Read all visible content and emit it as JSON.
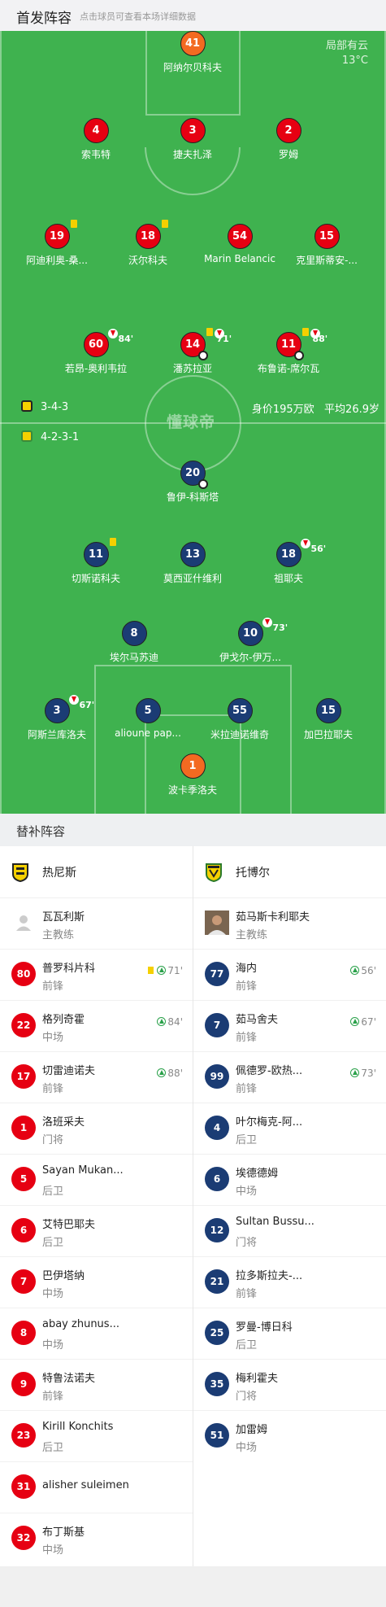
{
  "header": {
    "title": "首发阵容",
    "subtitle": "点击球员可查看本场详细数据"
  },
  "weather": {
    "line1": "局部有云",
    "line2": "13°C"
  },
  "pitch_logo": "懂球帝",
  "home": {
    "formation": "3-4-3",
    "players": [
      {
        "num": "41",
        "name": "阿纳尔贝科夫",
        "color": "orange"
      },
      {
        "num": "4",
        "name": "索韦特",
        "color": "red"
      },
      {
        "num": "3",
        "name": "捷夫扎泽",
        "color": "red"
      },
      {
        "num": "2",
        "name": "罗姆",
        "color": "red"
      },
      {
        "num": "19",
        "name": "阿迪利奥-桑...",
        "color": "red"
      },
      {
        "num": "18",
        "name": "沃尔科夫",
        "color": "red"
      },
      {
        "num": "54",
        "name": "Marin Belancic",
        "color": "red"
      },
      {
        "num": "15",
        "name": "克里斯蒂安-...",
        "color": "red"
      },
      {
        "num": "60",
        "name": "若昂-奥利韦拉",
        "color": "red",
        "sub_time": "84'"
      },
      {
        "num": "14",
        "name": "潘苏拉亚",
        "color": "red",
        "sub_time": "71'"
      },
      {
        "num": "11",
        "name": "布鲁诺-席尔瓦",
        "color": "red",
        "sub_time": "88'"
      }
    ]
  },
  "value_info": {
    "value": "身价195万欧",
    "age": "平均26.9岁"
  },
  "away": {
    "formation": "4-2-3-1",
    "players": [
      {
        "num": "20",
        "name": "鲁伊-科斯塔",
        "color": "blue"
      },
      {
        "num": "11",
        "name": "切斯诺科夫",
        "color": "blue"
      },
      {
        "num": "13",
        "name": "莫西亚什维利",
        "color": "blue"
      },
      {
        "num": "18",
        "name": "祖耶夫",
        "color": "blue",
        "sub_time": "56'"
      },
      {
        "num": "8",
        "name": "埃尔马苏迪",
        "color": "blue"
      },
      {
        "num": "10",
        "name": "伊戈尔-伊万...",
        "color": "blue",
        "sub_time": "73'"
      },
      {
        "num": "3",
        "name": "阿斯兰库洛夫",
        "color": "blue",
        "sub_time": "67'"
      },
      {
        "num": "5",
        "name": "alioune pap...",
        "color": "blue"
      },
      {
        "num": "55",
        "name": "米拉迪诺维奇",
        "color": "blue"
      },
      {
        "num": "15",
        "name": "加巴拉耶夫",
        "color": "blue"
      },
      {
        "num": "1",
        "name": "波卡季洛夫",
        "color": "orange"
      }
    ]
  },
  "subs": {
    "title": "替补阵容",
    "home_team": "热尼斯",
    "away_team": "托博尔",
    "home_coach": {
      "name": "瓦瓦利斯",
      "role": "主教练"
    },
    "away_coach": {
      "name": "茹马斯卡利耶夫",
      "role": "主教练"
    },
    "home": [
      {
        "num": "80",
        "name": "普罗科片科",
        "pos": "前锋",
        "time": "71'"
      },
      {
        "num": "22",
        "name": "格列奇霍",
        "pos": "中场",
        "time": "84'"
      },
      {
        "num": "17",
        "name": "切雷迪诺夫",
        "pos": "前锋",
        "time": "88'"
      },
      {
        "num": "1",
        "name": "洛班采夫",
        "pos": "门将",
        "time": ""
      },
      {
        "num": "5",
        "name": "Sayan Mukan...",
        "pos": "后卫",
        "time": ""
      },
      {
        "num": "6",
        "name": "艾特巴耶夫",
        "pos": "后卫",
        "time": ""
      },
      {
        "num": "7",
        "name": "巴伊塔纳",
        "pos": "中场",
        "time": ""
      },
      {
        "num": "8",
        "name": "abay zhunus...",
        "pos": "中场",
        "time": ""
      },
      {
        "num": "9",
        "name": "特鲁法诺夫",
        "pos": "前锋",
        "time": ""
      },
      {
        "num": "23",
        "name": "Kirill Konchits",
        "pos": "后卫",
        "time": ""
      },
      {
        "num": "31",
        "name": "alisher suleimen",
        "pos": "",
        "time": ""
      },
      {
        "num": "32",
        "name": "布丁斯基",
        "pos": "中场",
        "time": ""
      }
    ],
    "away": [
      {
        "num": "77",
        "name": "海内",
        "pos": "前锋",
        "time": "56'"
      },
      {
        "num": "7",
        "name": "茹马舍夫",
        "pos": "前锋",
        "time": "67'"
      },
      {
        "num": "99",
        "name": "佩德罗-欧热...",
        "pos": "前锋",
        "time": "73'"
      },
      {
        "num": "4",
        "name": "叶尔梅克-阿...",
        "pos": "后卫",
        "time": ""
      },
      {
        "num": "6",
        "name": "埃德德姆",
        "pos": "中场",
        "time": ""
      },
      {
        "num": "12",
        "name": "Sultan Bussu...",
        "pos": "门将",
        "time": ""
      },
      {
        "num": "21",
        "name": "拉多斯拉夫-...",
        "pos": "前锋",
        "time": ""
      },
      {
        "num": "25",
        "name": "罗曼-博日科",
        "pos": "后卫",
        "time": ""
      },
      {
        "num": "35",
        "name": "梅利霍夫",
        "pos": "门将",
        "time": ""
      },
      {
        "num": "51",
        "name": "加雷姆",
        "pos": "中场",
        "time": ""
      }
    ]
  }
}
